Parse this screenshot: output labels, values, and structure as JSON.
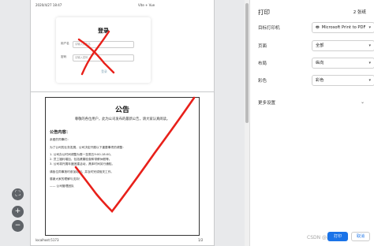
{
  "preview": {
    "page1": {
      "header_left": "2020/4/27 18:47",
      "header_right": "Vite + Vue",
      "login": {
        "title": "登录",
        "username_label": "用户名",
        "username_placeholder": "请输入用户名",
        "password_label": "密码",
        "password_placeholder": "请输入密码",
        "submit_label": "登录"
      }
    },
    "page2": {
      "notice_title": "公告",
      "notice_subtitle": "尊敬的各位用户，此为公司发布的最新公告，请大家认真阅读。",
      "notice_heading": "公告内容：",
      "notice_lines": [
        "亲爱的同事们：",
        "为了公司的业务发展，公司决定开展以下重要事项的调整：",
        "1. 公司办公时间调整为周一至周五9:00-18:00。",
        "2. 员工福利增加，包括健康检查和带薪休假等。",
        "3. 公司将开展年度团建活动，具体时间另行通知。",
        "请各位同事按时参加培训，并及时完成相关工作。",
        "感谢大家的理解与支持！",
        "—— 公司管理团队"
      ],
      "footer_left": "localhost:5173",
      "footer_right": "1/2"
    },
    "zoom": {
      "fit": "⛶",
      "plus": "+",
      "minus": "−"
    }
  },
  "settings": {
    "title": "打印",
    "sheet_count": "2 张纸",
    "rows": [
      {
        "label": "目标打印机",
        "value": "Microsoft Print to PDF",
        "icon": "printer-icon"
      },
      {
        "label": "页面",
        "value": "全部"
      },
      {
        "label": "布局",
        "value": "纵向"
      },
      {
        "label": "彩色",
        "value": "彩色"
      }
    ],
    "more_settings": "更多设置",
    "print_label": "打印",
    "cancel_label": "取消",
    "watermark": "CSDN @前端小白"
  },
  "colors": {
    "accent": "#1a73e8",
    "scribble": "#e8201a"
  }
}
